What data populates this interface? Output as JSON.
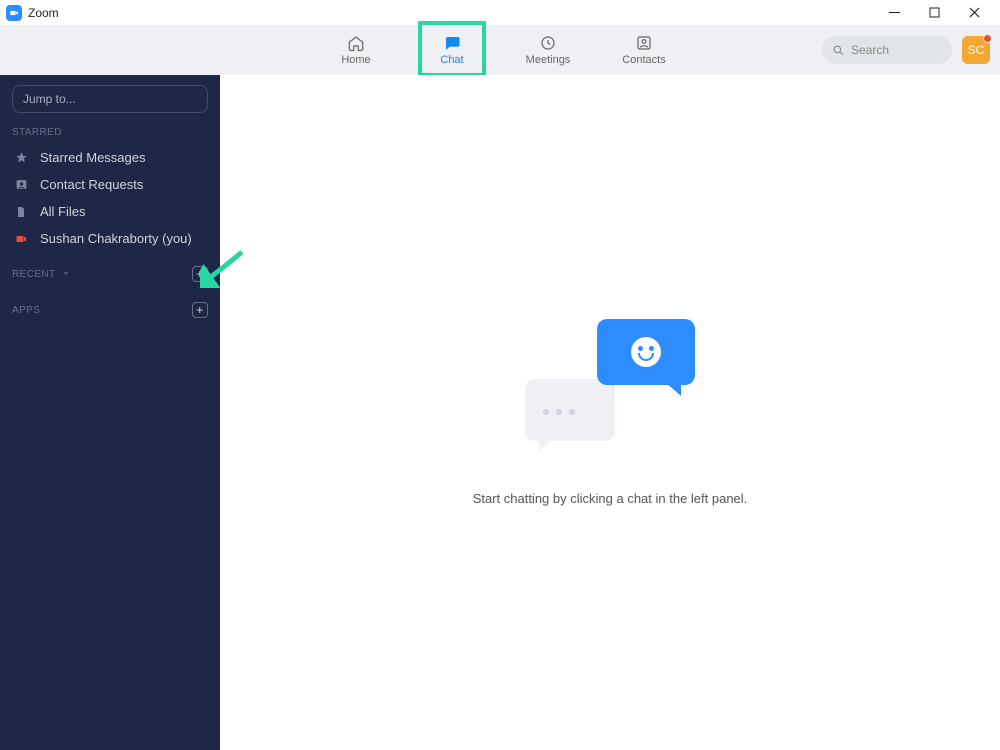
{
  "window": {
    "title": "Zoom"
  },
  "nav": {
    "home": "Home",
    "chat": "Chat",
    "meetings": "Meetings",
    "contacts": "Contacts"
  },
  "search": {
    "placeholder": "Search"
  },
  "avatar": {
    "initials": "SC"
  },
  "sidebar": {
    "jump_placeholder": "Jump to...",
    "sections": {
      "starred": "Starred",
      "recent": "Recent",
      "apps": "Apps"
    },
    "items": {
      "starred_messages": "Starred Messages",
      "contact_requests": "Contact Requests",
      "all_files": "All Files",
      "self": "Sushan Chakraborty (you)"
    }
  },
  "empty_state": {
    "text": "Start chatting by clicking a chat in the left panel."
  },
  "colors": {
    "accent": "#2D8CFF",
    "highlight": "#27d6a0",
    "sidebar_bg": "#1f2746"
  }
}
